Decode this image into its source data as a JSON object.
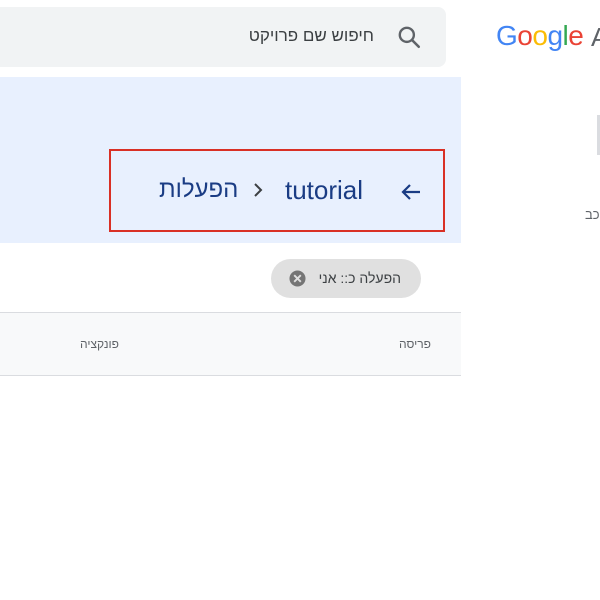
{
  "search": {
    "placeholder": "חיפוש שם פרויקט"
  },
  "breadcrumb": {
    "project": "tutorial",
    "page": "הפעלות"
  },
  "filter_chip": {
    "label": "הפעלה כ:: אני"
  },
  "table": {
    "columns": [
      "פריסה",
      "פונקציה"
    ]
  },
  "side_panel": {
    "logo_letters": [
      "G",
      "o",
      "o",
      "g",
      "l",
      "e"
    ],
    "logo_colors": [
      "#4285f4",
      "#ea4335",
      "#fbbc05",
      "#4285f4",
      "#34a853",
      "#ea4335"
    ],
    "logo_suffix": "A",
    "partial_text": "כב"
  },
  "icons": {
    "search": "search-icon",
    "back": "arrow-back-icon",
    "separator": "chevron-icon",
    "close": "close-circle-icon"
  }
}
